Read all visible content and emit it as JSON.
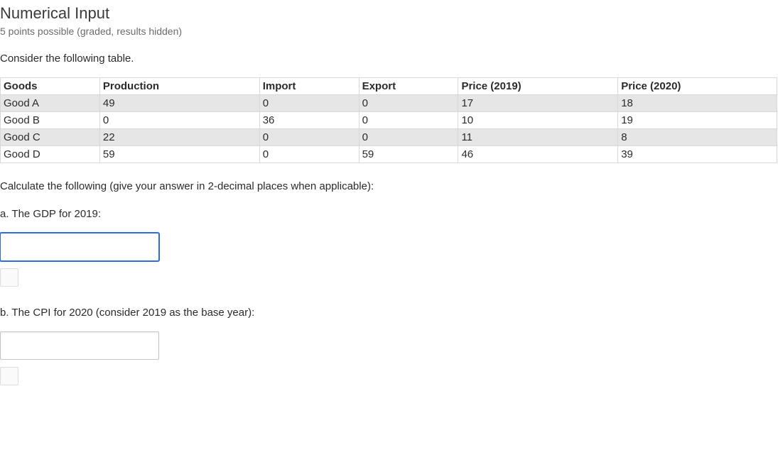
{
  "title": "Numerical Input",
  "subtitle": "5 points possible (graded, results hidden)",
  "intro": "Consider the following table.",
  "table": {
    "headers": [
      "Goods",
      "Production",
      "Import",
      "Export",
      "Price (2019)",
      "Price (2020)"
    ],
    "rows": [
      {
        "cells": [
          "Good A",
          "49",
          "0",
          "0",
          "17",
          "18"
        ],
        "shade": true
      },
      {
        "cells": [
          "Good B",
          "0",
          "36",
          "0",
          "10",
          "19"
        ],
        "shade": false
      },
      {
        "cells": [
          "Good C",
          "22",
          "0",
          "0",
          "11",
          "8"
        ],
        "shade": true
      },
      {
        "cells": [
          "Good D",
          "59",
          "0",
          "59",
          "46",
          "39"
        ],
        "shade": false
      }
    ]
  },
  "instruction": "Calculate the following (give your answer in 2-decimal places when applicable):",
  "questions": {
    "a": {
      "prompt": "a. The GDP for 2019:",
      "value": ""
    },
    "b": {
      "prompt": "b. The CPI for 2020 (consider 2019 as the base year):",
      "value": ""
    }
  }
}
